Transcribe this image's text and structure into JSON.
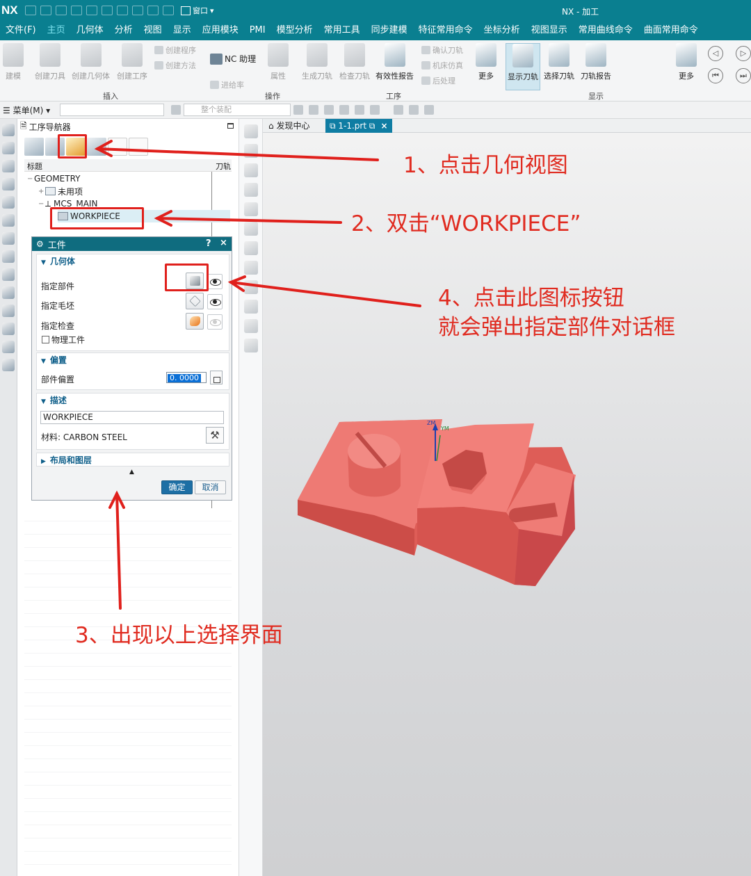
{
  "titlebar": {
    "logo": "NX",
    "window_menu": "窗口",
    "app_title": "NX - 加工"
  },
  "menubar": {
    "tabs": [
      {
        "label": "文件(F)"
      },
      {
        "label": "主页",
        "active": true
      },
      {
        "label": "几何体"
      },
      {
        "label": "分析"
      },
      {
        "label": "视图"
      },
      {
        "label": "显示"
      },
      {
        "label": "应用模块"
      },
      {
        "label": "PMI"
      },
      {
        "label": "模型分析"
      },
      {
        "label": "常用工具"
      },
      {
        "label": "同步建模"
      },
      {
        "label": "特征常用命令"
      },
      {
        "label": "坐标分析"
      },
      {
        "label": "视图显示"
      },
      {
        "label": "常用曲线命令"
      },
      {
        "label": "曲面常用命令"
      }
    ]
  },
  "ribbon": {
    "buttons": {
      "build": "建模",
      "create_tool": "创建刀具",
      "create_geometry": "创建几何体",
      "create_operation": "创建工序",
      "nc_assistant": "NC 助理",
      "attribute": "属性",
      "generate_toolpath": "生成刀轨",
      "verify_tool": "检查刀轨",
      "validity_report": "有效性报告",
      "more1": "更多",
      "show_toolpath": "显示刀轨",
      "select_toolpath": "选择刀轨",
      "toolpath_report": "刀轨报告",
      "more2": "更多"
    },
    "small": {
      "create_program": "创建程序",
      "create_method": "创建方法",
      "feed_rate": "进给率",
      "confirm_toolpath": "确认刀轨",
      "machine_sim": "机床仿真",
      "post_process": "后处理"
    },
    "groups": {
      "insert": "插入",
      "operation": "操作",
      "process": "工序",
      "display": "显示"
    }
  },
  "toolbar2": {
    "menu_label": "菜单(M)",
    "assembly_placeholder": "整个装配"
  },
  "navigator": {
    "title": "工序导航器",
    "col_title": "标题",
    "col_tool": "刀轨",
    "tree": {
      "geometry": "GEOMETRY",
      "unused": "未用项",
      "mcs": "MCS_MAIN",
      "workpiece": "WORKPIECE"
    }
  },
  "dialog": {
    "title": "工件",
    "help": "?",
    "close": "×",
    "geometry_section": "几何体",
    "specify_part": "指定部件",
    "specify_blank": "指定毛坯",
    "specify_check": "指定检查",
    "physical_workpiece": "物理工件",
    "offset_section": "偏置",
    "part_offset": "部件偏置",
    "part_offset_value": "0. 0000",
    "description_section": "描述",
    "description_value": "WORKPIECE",
    "material": "材料: CARBON STEEL",
    "layout_section": "布局和图层",
    "ok": "确定",
    "cancel": "取消"
  },
  "graphics": {
    "tab_discovery": "发现中心",
    "tab_file": "1-1.prt",
    "axis_z": "ZM",
    "axis_y": "YM",
    "part_color": "#e8635c"
  },
  "annotations": {
    "step1": "1、点击几何视图",
    "step2": "2、双击“WORKPIECE”",
    "step3": "3、出现以上选择界面",
    "step4_line1": "4、点击此图标按钮",
    "step4_line2": "就会弹出指定部件对话框"
  },
  "colors": {
    "titlebar": "#0a7f90",
    "annotation": "#e02b20",
    "dialog_header": "#0f6c7f"
  }
}
